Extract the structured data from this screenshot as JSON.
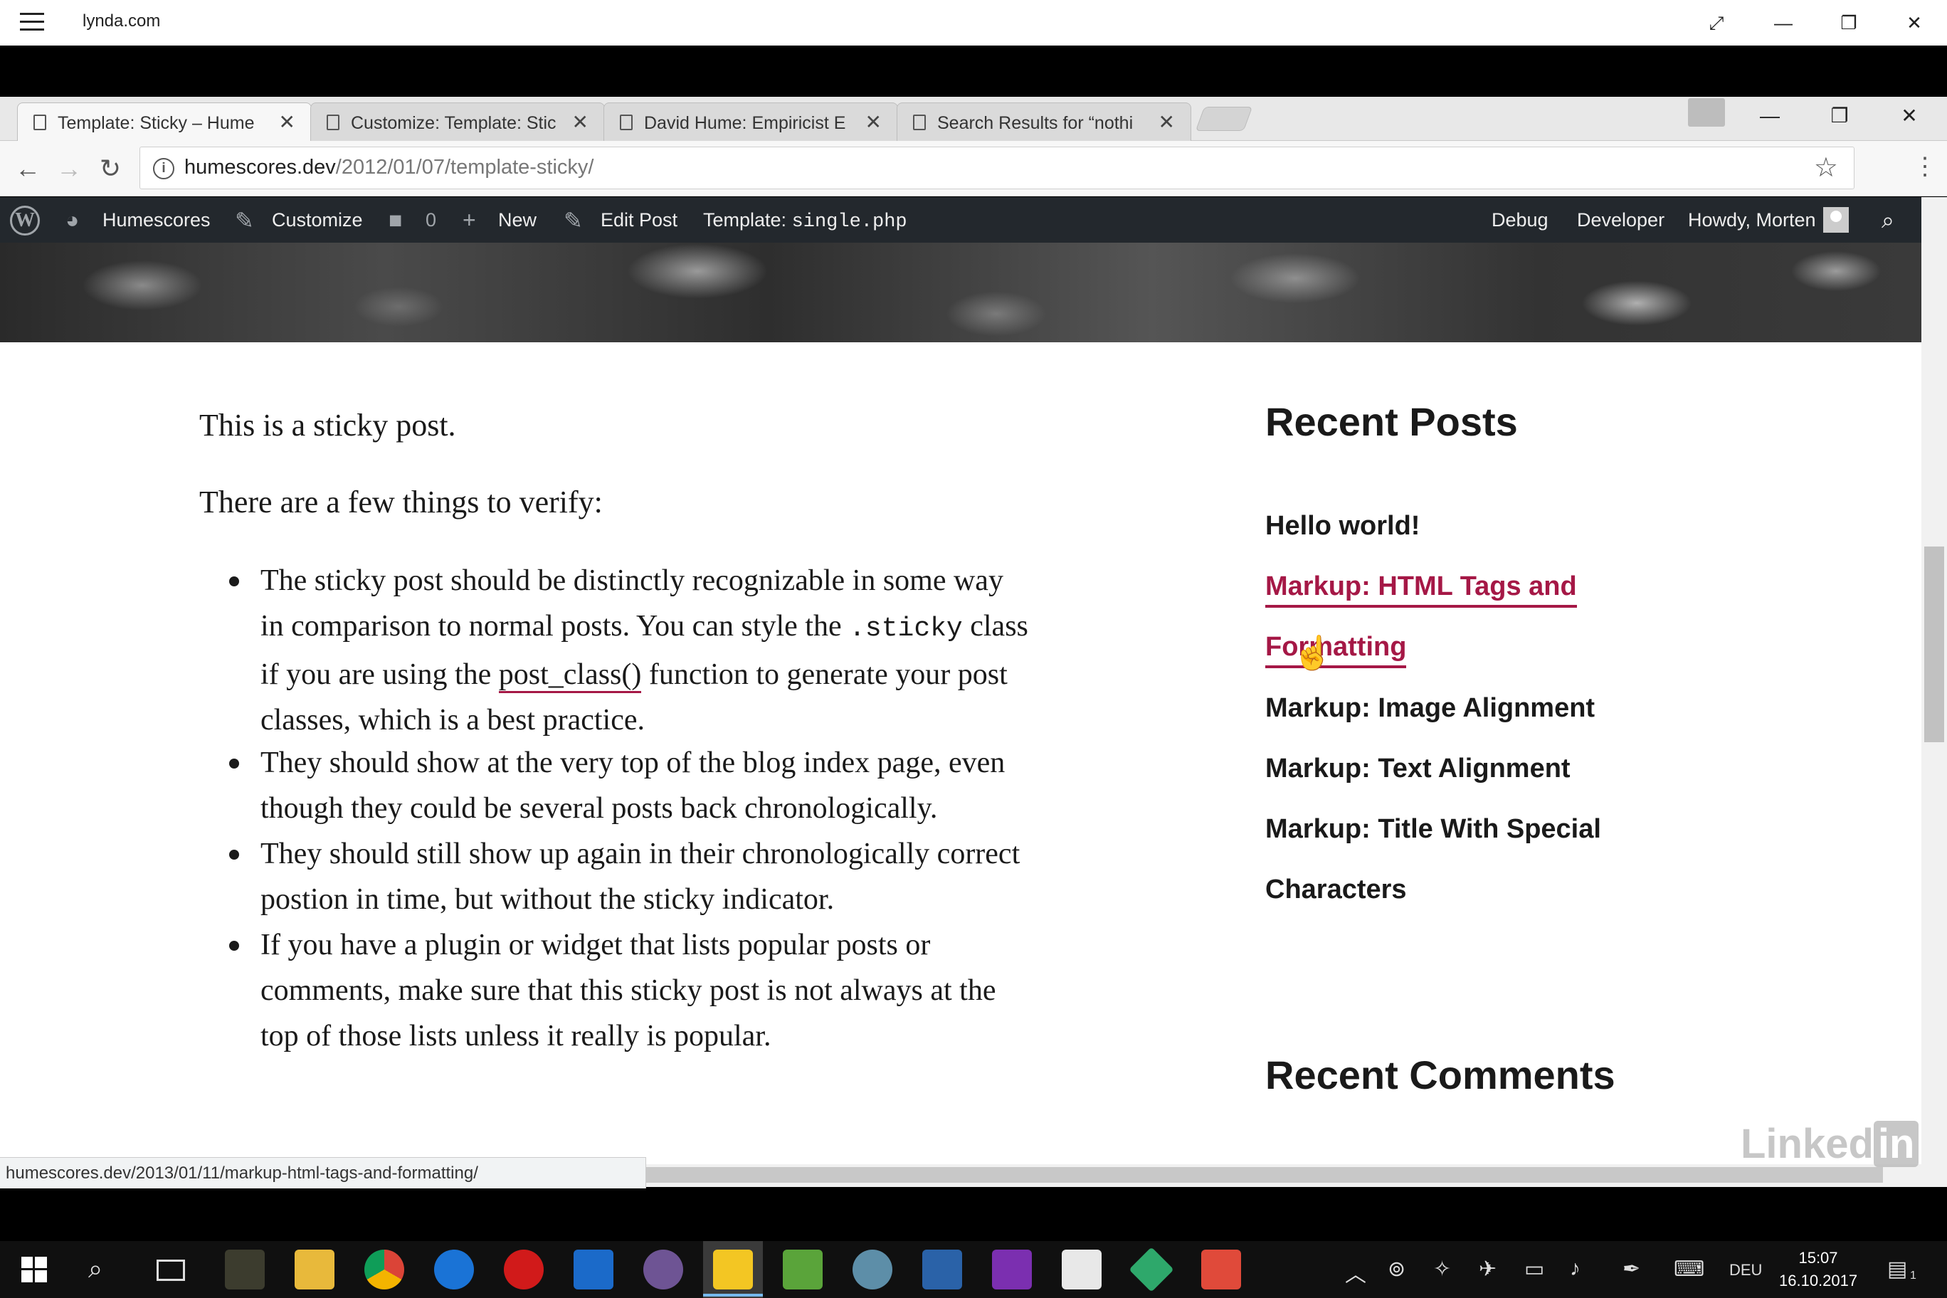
{
  "app": {
    "title": "lynda.com",
    "controls": [
      "⤢",
      "—",
      "❐",
      "✕"
    ]
  },
  "chrome": {
    "tabs": [
      {
        "label": "Template: Sticky – Hume",
        "close": "✕"
      },
      {
        "label": "Customize: Template: Stic",
        "close": "✕"
      },
      {
        "label": "David Hume: Empiricist E",
        "close": "✕"
      },
      {
        "label": "Search Results for “nothi",
        "close": "✕"
      }
    ],
    "window_controls": [
      "—",
      "❐",
      "✕"
    ],
    "nav": {
      "back": "←",
      "forward": "→",
      "reload": "↻"
    },
    "url": {
      "host": "humescores.dev",
      "path": "/2012/01/07/template-sticky/"
    },
    "star": "☆",
    "menu": "⋮"
  },
  "adminbar": {
    "site": "Humescores",
    "customize": "Customize",
    "comments_count": "0",
    "new": "New",
    "edit_post": "Edit Post",
    "template_label": "Template:",
    "template_file": "single.php",
    "debug": "Debug",
    "developer": "Developer",
    "howdy": "Howdy, Morten"
  },
  "post": {
    "p1": "This is a sticky post.",
    "p2": "There are a few things to verify:",
    "li1": {
      "l1": "The sticky post should be distinctly recognizable in some way",
      "l2a": "in comparison to normal posts. You can style the ",
      "l2code": ".sticky",
      "l2b": " class",
      "l3a": "if you are using the ",
      "l3link": "post_class()",
      "l3b": " function to generate your post",
      "l4": "classes, which is a best practice."
    },
    "li2": {
      "l1": "They should show at the very top of the blog index page, even",
      "l2": "though they could be several posts back chronologically."
    },
    "li3": {
      "l1": "They should still show up again in their chronologically correct",
      "l2": "postion in time, but without the sticky indicator."
    },
    "li4": {
      "l1": "If you have a plugin or widget that lists popular posts or",
      "l2": "comments, make sure that this sticky post is not always at the",
      "l3": "top of those lists unless it really is popular."
    }
  },
  "sidebar": {
    "recent_posts_title": "Recent Posts",
    "posts": [
      "Hello world!",
      "Markup: HTML Tags and",
      "Formatting",
      "Markup: Image Alignment",
      "Markup: Text Alignment",
      "Markup: Title With Special",
      "Characters"
    ],
    "recent_comments_title": "Recent Comments"
  },
  "status_url": "humescores.dev/2013/01/11/markup-html-tags-and-formatting/",
  "watermark": "Linked",
  "watermark_in": "in",
  "taskbar": {
    "language": "DEU",
    "time": "15:07",
    "date": "16.10.2017",
    "notifications": "1"
  },
  "colors": {
    "link_accent": "#a51846",
    "adminbar": "#23282d"
  }
}
